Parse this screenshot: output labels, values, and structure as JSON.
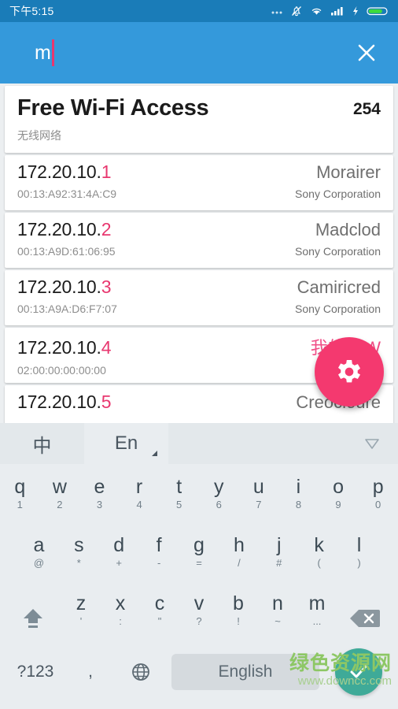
{
  "status_bar": {
    "clock": "下午5:15",
    "icons": [
      "more-ellipsis-icon",
      "bell-muted-icon",
      "wifi-icon",
      "signal-bars-icon",
      "charging-bolt-icon",
      "battery-icon"
    ],
    "background": "#1a7cb8"
  },
  "app_bar": {
    "search_value": "m",
    "search_placeholder": "",
    "close_label": "×",
    "background": "#3499db",
    "caret_color": "#e8376f"
  },
  "header_card": {
    "title": "Free Wi-Fi Access",
    "count": "254",
    "subtitle": "无线网络"
  },
  "list": {
    "rows": [
      {
        "ip_prefix": "172.20.10.",
        "ip_octet": "1",
        "mac": "00:13:A92:31:4A:C9",
        "name": "Morairer",
        "vendor": "Sony Corporation",
        "name_highlight": false
      },
      {
        "ip_prefix": "172.20.10.",
        "ip_octet": "2",
        "mac": "00:13:A9D:61:06:95",
        "name": "Madclod",
        "vendor": "Sony Corporation",
        "name_highlight": false
      },
      {
        "ip_prefix": "172.20.10.",
        "ip_octet": "3",
        "mac": "00:13:A9A:D6:F7:07",
        "name": "Camiricred",
        "vendor": "Sony Corporation",
        "name_highlight": false
      },
      {
        "ip_prefix": "172.20.10.",
        "ip_octet": "4",
        "mac": "02:00:00:00:00:00",
        "name": "我的 MW",
        "vendor": "",
        "name_highlight": true
      },
      {
        "ip_prefix": "172.20.10.",
        "ip_octet": "5",
        "mac": "",
        "name": "Creocloure",
        "vendor": "",
        "name_highlight": false
      }
    ],
    "octet_color": "#e8376f"
  },
  "fab": {
    "icon": "gear-icon",
    "color": "#f4396f"
  },
  "keyboard": {
    "toolbar": {
      "tab_chinese": "中",
      "tab_english": "En",
      "selected": "En",
      "collapse_icon": "chevron-down-triangle-icon"
    },
    "row1": [
      {
        "main": "q",
        "sub": "1"
      },
      {
        "main": "w",
        "sub": "2"
      },
      {
        "main": "e",
        "sub": "3"
      },
      {
        "main": "r",
        "sub": "4"
      },
      {
        "main": "t",
        "sub": "5"
      },
      {
        "main": "y",
        "sub": "6"
      },
      {
        "main": "u",
        "sub": "7"
      },
      {
        "main": "i",
        "sub": "8"
      },
      {
        "main": "o",
        "sub": "9"
      },
      {
        "main": "p",
        "sub": "0"
      }
    ],
    "row2": [
      {
        "main": "a",
        "sub": "@"
      },
      {
        "main": "s",
        "sub": "*"
      },
      {
        "main": "d",
        "sub": "+"
      },
      {
        "main": "f",
        "sub": "-"
      },
      {
        "main": "g",
        "sub": "="
      },
      {
        "main": "h",
        "sub": "/"
      },
      {
        "main": "j",
        "sub": "#"
      },
      {
        "main": "k",
        "sub": "("
      },
      {
        "main": "l",
        "sub": ")"
      }
    ],
    "row3": [
      {
        "main": "z",
        "sub": "'"
      },
      {
        "main": "x",
        "sub": ":"
      },
      {
        "main": "c",
        "sub": "\""
      },
      {
        "main": "v",
        "sub": "?"
      },
      {
        "main": "b",
        "sub": "!"
      },
      {
        "main": "n",
        "sub": "~"
      },
      {
        "main": "m",
        "sub": "..."
      }
    ],
    "shift_icon": "shift-arrow-icon",
    "backspace_icon": "backspace-icon",
    "row4": {
      "symbols_label": "?123",
      "comma_label": ",",
      "globe_icon": "globe-icon",
      "space_label": "English",
      "enter_icon": "check-icon",
      "enter_color": "#3faa98"
    }
  },
  "watermark": {
    "main": "绿色资源网",
    "url": "www.downcc.com"
  }
}
